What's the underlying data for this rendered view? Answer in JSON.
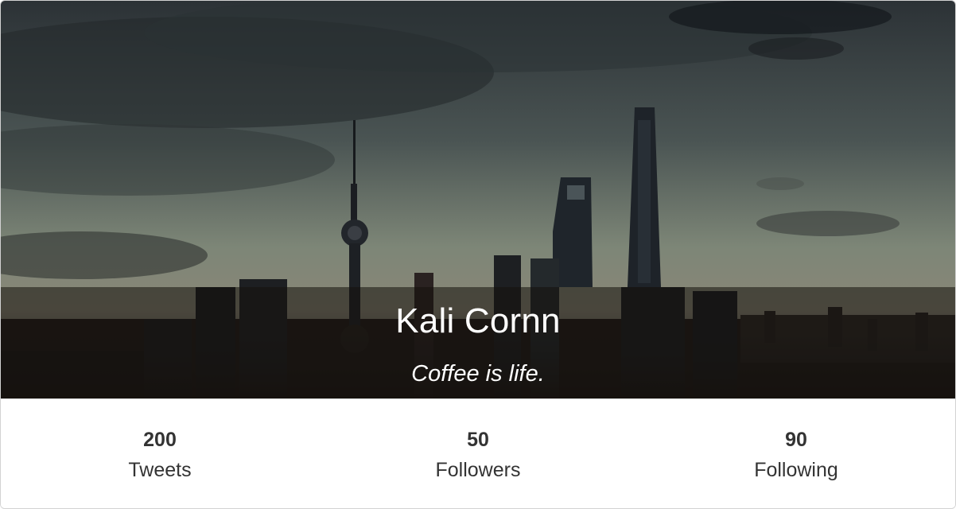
{
  "profile": {
    "name": "Kali Cornn",
    "bio": "Coffee is life."
  },
  "stats": [
    {
      "count": "200",
      "label": "Tweets"
    },
    {
      "count": "50",
      "label": "Followers"
    },
    {
      "count": "90",
      "label": "Following"
    }
  ],
  "colors": {
    "overlay": "#14100c",
    "text_light": "#ffffff",
    "text_dark": "#333333",
    "border": "#d2d2d2"
  }
}
